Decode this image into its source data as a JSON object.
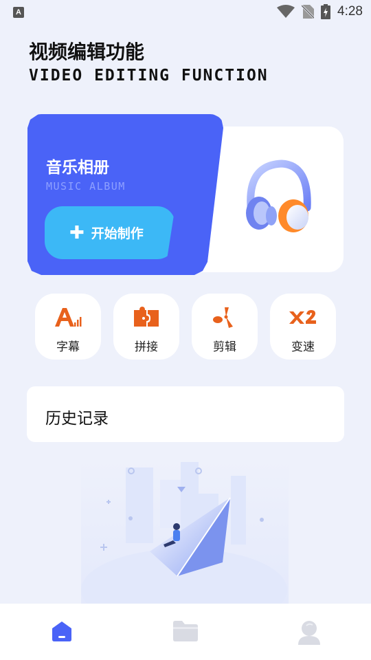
{
  "status_bar": {
    "time": "4:28",
    "app_icon_letter": "A"
  },
  "header": {
    "title_cn": "视频编辑功能",
    "title_en": "VIDEO EDITING FUNCTION"
  },
  "album_card": {
    "title": "音乐相册",
    "subtitle": "MUSIC ALBUM",
    "start_label": "开始制作",
    "start_icon": "plus-icon",
    "image": "headphones-illustration"
  },
  "tools": [
    {
      "label": "字幕",
      "icon": "subtitle-icon"
    },
    {
      "label": "拼接",
      "icon": "puzzle-icon"
    },
    {
      "label": "剪辑",
      "icon": "scissors-icon"
    },
    {
      "label": "变速",
      "icon": "speed-x2-icon"
    }
  ],
  "history": {
    "label": "历史记录"
  },
  "bottom_nav": [
    {
      "icon": "home-icon",
      "active": true
    },
    {
      "icon": "folder-icon",
      "active": false
    },
    {
      "icon": "profile-icon",
      "active": false
    }
  ],
  "colors": {
    "accent_blue": "#4a63f7",
    "button_cyan": "#3cb8f6",
    "tool_orange": "#e8611c",
    "background": "#eef1fb"
  }
}
